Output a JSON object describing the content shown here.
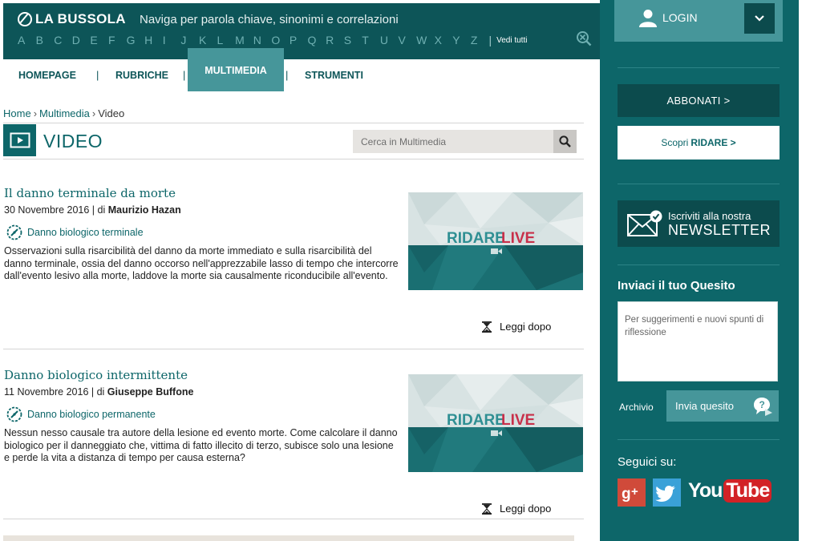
{
  "header": {
    "logo": "LA BUSSOLA",
    "tagline": "Naviga per parola chiave, sinonimi e correlazioni",
    "alphabet": [
      "A",
      "B",
      "C",
      "D",
      "E",
      "F",
      "G",
      "H",
      "I",
      "J",
      "K",
      "L",
      "M",
      "N",
      "O",
      "P",
      "Q",
      "R",
      "S",
      "T",
      "U",
      "V",
      "W",
      "X",
      "Y",
      "Z"
    ],
    "alphabet_all": "Vedi tutti"
  },
  "nav": {
    "items": [
      "HOMEPAGE",
      "RUBRICHE",
      "MULTIMEDIA",
      "STRUMENTI"
    ],
    "active": "MULTIMEDIA"
  },
  "breadcrumb": [
    "Home",
    "Multimedia",
    "Video"
  ],
  "page": {
    "title": "VIDEO",
    "search_placeholder": "Cerca in Multimedia"
  },
  "articles": [
    {
      "title": "Il danno terminale da morte",
      "date": "30 Novembre 2016 | di",
      "author": "Maurizio Hazan",
      "tag": "Danno biologico terminale",
      "description": "Osservazioni sulla risarcibilità del danno da morte immediato e sulla risarcibilità del danno terminale, ossia del danno occorso nell'apprezzabile lasso di tempo che intercorre dall'evento lesivo alla morte, laddove la morte sia causalmente riconducibile all'evento.",
      "thumb_brand_a": "RIDARE",
      "thumb_brand_b": "LIVE",
      "read_later": "Leggi dopo"
    },
    {
      "title": "Danno biologico intermittente",
      "date": "11 Novembre 2016 | di",
      "author": "Giuseppe Buffone",
      "tag": "Danno biologico permanente",
      "description": "Nessun nesso causale tra autore della lesione ed evento morte. Come calcolare il danno biologico per il danneggiato che, vittima di fatto illecito di terzo, subisce solo una lesione e perde la vita a distanza di tempo per causa esterna?",
      "thumb_brand_a": "RIDARE",
      "thumb_brand_b": "LIVE",
      "read_later": "Leggi dopo"
    }
  ],
  "sidebar": {
    "login": "LOGIN",
    "abbonati": "ABBONATI >",
    "ridare_prefix": "Scopri",
    "ridare_brand": "RIDARE >",
    "newsletter_line1": "Iscriviti alla nostra",
    "newsletter_line2": "NEWSLETTER",
    "quesito_title": "Inviaci il tuo Quesito",
    "quesito_placeholder": "Per suggerimenti e nuovi spunti di riflessione",
    "archivio": "Archivio",
    "invia": "Invia quesito",
    "seguici": "Seguici su:",
    "youtube_a": "You",
    "youtube_b": "Tube"
  },
  "colors": {
    "dark_teal": "#0d5558",
    "teal": "#0d6669",
    "light_teal": "#46969a",
    "ridare_red": "#c8304a"
  }
}
